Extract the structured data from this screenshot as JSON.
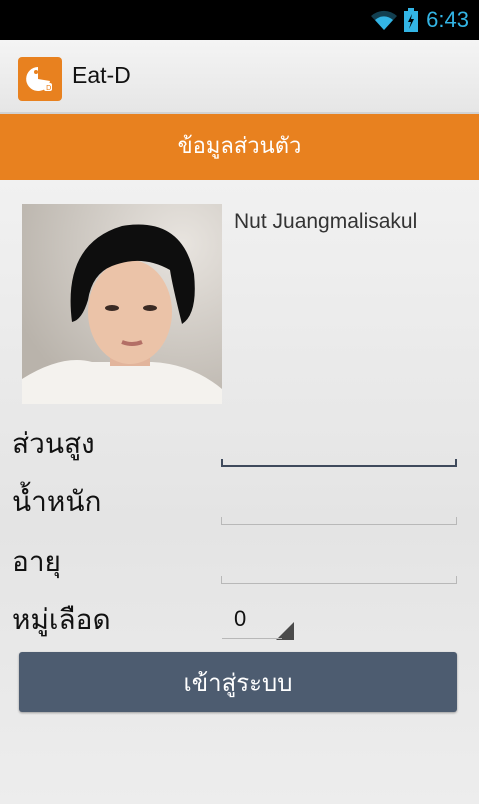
{
  "status_bar": {
    "time": "6:43",
    "wifi_icon": "wifi-icon",
    "battery_icon": "battery-icon"
  },
  "app": {
    "title": "Eat-D",
    "icon": "app-logo-icon"
  },
  "header": {
    "title": "ข้อมูลส่วนตัว"
  },
  "profile": {
    "name": "Nut Juangmalisakul",
    "photo": "profile-photo"
  },
  "form": {
    "height_label": "ส่วนสูง",
    "height_value": "",
    "weight_label": "น้ำหนัก",
    "weight_value": "",
    "age_label": "อายุ",
    "age_value": "",
    "blood_group_label": "หมู่เลือด",
    "blood_group_value": "0"
  },
  "login_button": {
    "label": "เข้าสู่ระบบ"
  },
  "colors": {
    "accent": "#e8811f",
    "button": "#4d5c70",
    "status_text": "#33b5e5"
  }
}
